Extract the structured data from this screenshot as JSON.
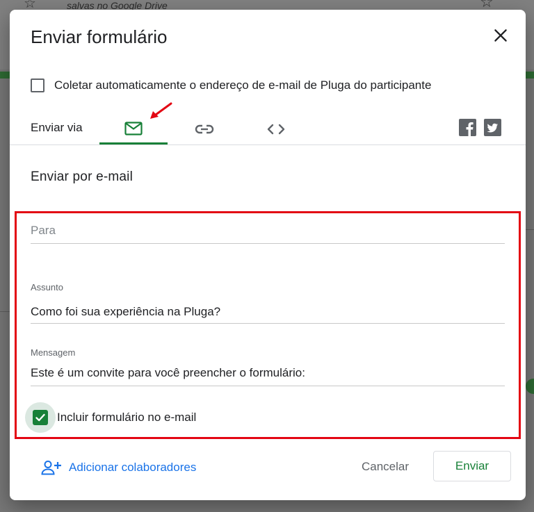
{
  "background": {
    "drive_note": "salvas no Google Drive"
  },
  "dialog": {
    "title": "Enviar formulário",
    "collect_email": {
      "label": "Coletar automaticamente o endereço de e-mail de Pluga do participante",
      "checked": false
    },
    "send_via": {
      "label": "Enviar via",
      "tabs": [
        {
          "name": "email",
          "icon": "mail-icon",
          "active": true
        },
        {
          "name": "link",
          "icon": "link-icon",
          "active": false
        },
        {
          "name": "embed",
          "icon": "code-icon",
          "active": false
        }
      ],
      "social": [
        {
          "name": "facebook",
          "icon": "facebook-icon"
        },
        {
          "name": "twitter",
          "icon": "twitter-icon"
        }
      ]
    },
    "email_section": {
      "title": "Enviar por e-mail",
      "to": {
        "placeholder": "Para",
        "value": ""
      },
      "subject": {
        "label": "Assunto",
        "value": "Como foi sua experiência na Pluga?"
      },
      "message": {
        "label": "Mensagem",
        "value": "Este é um convite para você preencher o formulário:"
      },
      "include_form": {
        "label": "Incluir formulário no e-mail",
        "checked": true
      }
    },
    "footer": {
      "add_collaborators": "Adicionar colaboradores",
      "cancel": "Cancelar",
      "send": "Enviar"
    }
  },
  "colors": {
    "accent_green": "#188038",
    "link_blue": "#1a73e8",
    "highlight_red": "#e30613"
  }
}
